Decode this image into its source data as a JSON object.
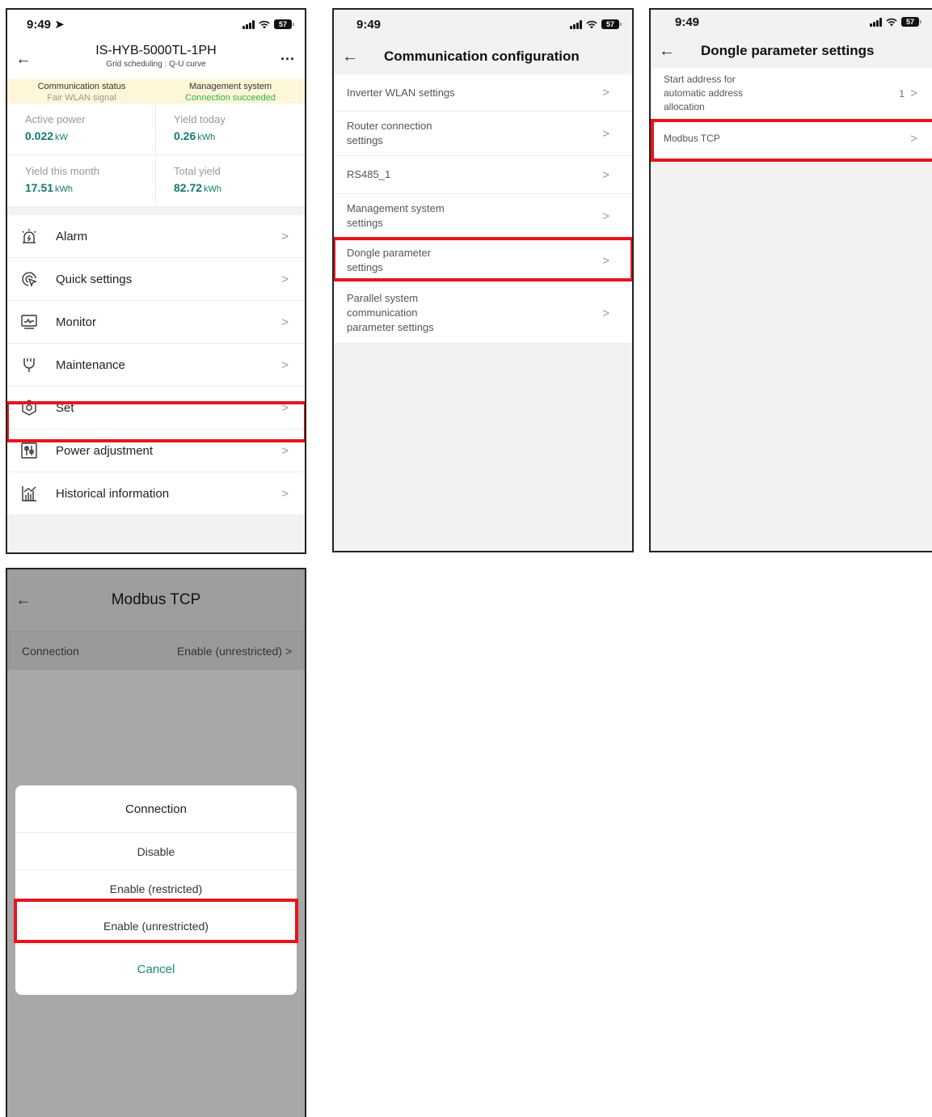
{
  "status_time": "9:49",
  "battery": "57",
  "screen1": {
    "device_name": "IS-HYB-5000TL-1PH",
    "subtitle": "Grid scheduling : Q-U curve",
    "more": "...",
    "communication_status_label": "Communication status",
    "communication_status_value": "Fair WLAN signal",
    "management_system_label": "Management system",
    "management_system_value": "Connection succeeded",
    "stats": [
      {
        "label": "Active power",
        "value": "0.022",
        "unit": "kW"
      },
      {
        "label": "Yield today",
        "value": "0.26",
        "unit": "kWh"
      },
      {
        "label": "Yield this month",
        "value": "17.51",
        "unit": "kWh"
      },
      {
        "label": "Total yield",
        "value": "82.72",
        "unit": "kWh"
      }
    ],
    "menu": [
      {
        "label": "Alarm",
        "icon": "alarm-icon"
      },
      {
        "label": "Quick settings",
        "icon": "quick-settings-icon"
      },
      {
        "label": "Monitor",
        "icon": "monitor-icon"
      },
      {
        "label": "Maintenance",
        "icon": "maintenance-icon"
      },
      {
        "label": "Set",
        "icon": "set-icon"
      },
      {
        "label": "Power adjustment",
        "icon": "power-adjustment-icon"
      },
      {
        "label": "Historical information",
        "icon": "history-icon"
      }
    ]
  },
  "screen2": {
    "title": "Communication configuration",
    "items": [
      {
        "label": "Inverter WLAN settings"
      },
      {
        "label": "Router connection settings"
      },
      {
        "label": "RS485_1"
      },
      {
        "label": "Management system settings"
      },
      {
        "label": "Dongle parameter settings"
      },
      {
        "label": "Parallel system communication parameter settings"
      }
    ]
  },
  "screen3": {
    "title": "Dongle parameter settings",
    "items": [
      {
        "label": "Start address for automatic address allocation",
        "value": "1"
      },
      {
        "label": "Modbus TCP"
      }
    ]
  },
  "screen4": {
    "title": "Modbus TCP",
    "connection_label": "Connection",
    "connection_value": "Enable (unrestricted)",
    "sheet_title": "Connection",
    "options": [
      "Disable",
      "Enable (restricted)",
      "Enable (unrestricted)"
    ],
    "cancel": "Cancel"
  },
  "colors": {
    "accent": "#127a6a",
    "highlight": "#e8141d",
    "success": "#2eb24e",
    "banner": "#fdf6d8"
  }
}
